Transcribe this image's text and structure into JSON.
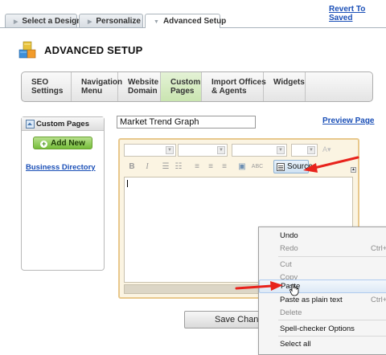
{
  "header": {
    "revert_link": "Revert To Saved"
  },
  "tabs": [
    {
      "label": "Select a Design"
    },
    {
      "label": "Personalize"
    },
    {
      "label": "Advanced Setup"
    }
  ],
  "page": {
    "title": "ADVANCED SETUP"
  },
  "nav": {
    "items": [
      {
        "label": "SEO\nSettings"
      },
      {
        "label": "Navigation\nMenu"
      },
      {
        "label": "Website\nDomain"
      },
      {
        "label": "Custom\nPages"
      },
      {
        "label": "Import Offices\n& Agents"
      },
      {
        "label": "Widgets"
      }
    ],
    "active_index": 3
  },
  "sidebar": {
    "title": "Custom Pages",
    "add_new": "Add New",
    "add_new_color": "#76bd3a",
    "items": [
      {
        "label": "Business Directory"
      }
    ]
  },
  "editor": {
    "page_name_value": "Market Trend Graph",
    "preview_link": "Preview Page",
    "source_button": "Source",
    "border_color": "#e8c88c",
    "toolbar_icons": [
      "bold-icon",
      "italic-icon",
      "numbered-list-icon",
      "bulleted-list-icon",
      "align-left-icon",
      "align-center-icon",
      "align-right-icon",
      "image-icon",
      "spellcheck-icon",
      "source-icon"
    ]
  },
  "save_button": "Save Changes",
  "context_menu": {
    "items": [
      {
        "label": "Undo",
        "shortcut": "",
        "disabled": false
      },
      {
        "label": "Redo",
        "shortcut": "Ctrl+S",
        "disabled": true
      },
      {
        "label": "Cut",
        "shortcut": "",
        "disabled": true
      },
      {
        "label": "Copy",
        "shortcut": "",
        "disabled": true
      },
      {
        "label": "Paste",
        "shortcut": "",
        "disabled": false
      },
      {
        "label": "Paste as plain text",
        "shortcut": "Ctrl+S",
        "disabled": false
      },
      {
        "label": "Delete",
        "shortcut": "",
        "disabled": true
      },
      {
        "label": "Spell-checker Options",
        "shortcut": "",
        "disabled": false
      },
      {
        "label": "Select all",
        "shortcut": "",
        "disabled": false
      }
    ],
    "hover_index": 4
  },
  "annotation_color": "#e8231c"
}
